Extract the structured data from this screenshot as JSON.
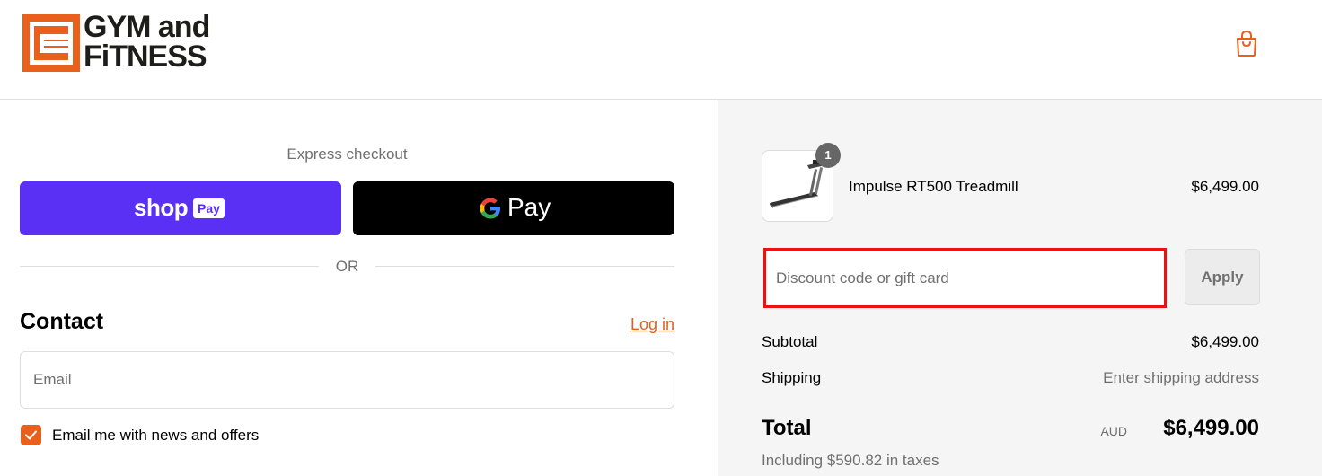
{
  "brand": {
    "logo_line1": "GYM and",
    "logo_line2": "FiTNESS",
    "accent_color": "#e8601c"
  },
  "header": {
    "cart_icon": "shopping-bag-icon"
  },
  "express": {
    "title": "Express checkout",
    "shop_pay_word": "shop",
    "shop_pay_badge": "Pay",
    "gpay_label": "Pay",
    "separator": "OR"
  },
  "contact": {
    "title": "Contact",
    "login_link": "Log in",
    "email_placeholder": "Email",
    "email_value": "",
    "newsletter_label": "Email me with news and offers",
    "newsletter_checked": true
  },
  "order": {
    "item": {
      "name": "Impulse RT500 Treadmill",
      "price": "$6,499.00",
      "quantity": "1",
      "image_icon": "treadmill-icon"
    },
    "discount": {
      "placeholder": "Discount code or gift card",
      "value": "",
      "apply_label": "Apply"
    },
    "subtotal_label": "Subtotal",
    "subtotal_value": "$6,499.00",
    "shipping_label": "Shipping",
    "shipping_value": "Enter shipping address",
    "total_label": "Total",
    "total_currency": "AUD",
    "total_value": "$6,499.00",
    "tax_note": "Including $590.82 in taxes"
  }
}
